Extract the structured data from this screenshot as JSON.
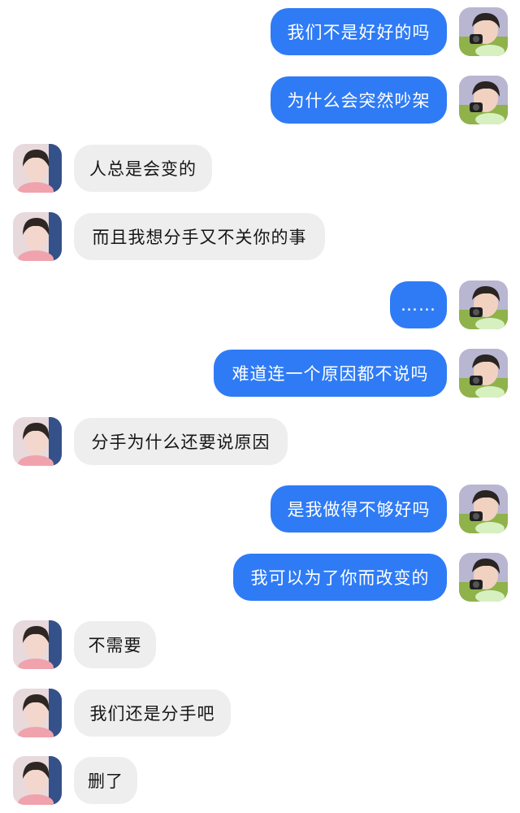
{
  "colors": {
    "outgoing_bubble": "#2f7bf5",
    "incoming_bubble": "#eeeeee",
    "background": "#ffffff"
  },
  "messages": [
    {
      "side": "right",
      "text": "我们不是好好的吗"
    },
    {
      "side": "right",
      "text": "为什么会突然吵架"
    },
    {
      "side": "left",
      "text": "人总是会变的"
    },
    {
      "side": "left",
      "text": "而且我想分手又不关你的事"
    },
    {
      "side": "right",
      "text": "……"
    },
    {
      "side": "right",
      "text": "难道连一个原因都不说吗"
    },
    {
      "side": "left",
      "text": "分手为什么还要说原因"
    },
    {
      "side": "right",
      "text": "是我做得不够好吗"
    },
    {
      "side": "right",
      "text": "我可以为了你而改变的"
    },
    {
      "side": "left",
      "text": "不需要"
    },
    {
      "side": "left",
      "text": "我们还是分手吧"
    },
    {
      "side": "left",
      "text": "删了"
    }
  ]
}
